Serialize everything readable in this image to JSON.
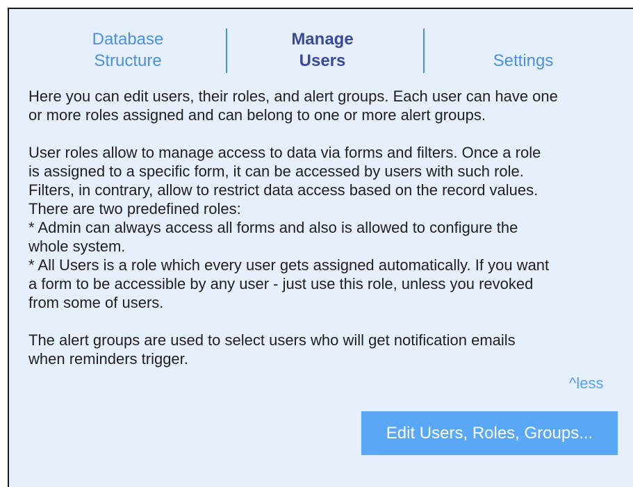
{
  "tabs": {
    "database_structure": [
      "Database",
      "Structure"
    ],
    "manage_users": [
      "Manage",
      "Users"
    ],
    "settings": "Settings"
  },
  "description": {
    "p1": "Here you can edit users, their roles, and alert groups. Each user can have one\nor more roles assigned and can belong to one or more alert groups.",
    "p2": "User roles allow to manage access to data via forms and filters. Once a role\nis assigned to a specific form, it can be accessed by users with such role.\nFilters, in contrary, allow to restrict data access based on the record values.\nThere are two predefined roles:\n* Admin can always access all forms and also is allowed to configure the\nwhole system.\n* All Users is a role which every user gets assigned automatically. If you want\na form to be accessible by any user - just use this role, unless you revoked\nfrom some of users.",
    "p3": "The alert groups are used to select users who will get notification emails\nwhen reminders trigger."
  },
  "less_link": "^less",
  "edit_button": "Edit Users, Roles, Groups...",
  "colors": {
    "panel_background": "#e6f0fc",
    "tab_link": "#4a90e2",
    "tab_active": "#3a4a9a",
    "button_background": "#5aa8f5"
  }
}
